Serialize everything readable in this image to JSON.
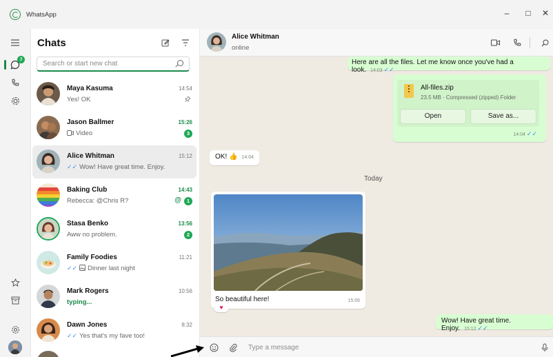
{
  "window": {
    "app_title": "WhatsApp",
    "controls": {
      "minimize": "–",
      "maximize": "□",
      "close": "✕"
    }
  },
  "rail": {
    "icons": [
      "menu-icon",
      "chats-icon",
      "calls-icon",
      "status-icon",
      "starred-icon",
      "archive-icon",
      "settings-icon",
      "profile-avatar"
    ],
    "chats_badge": "3"
  },
  "chat_list": {
    "title": "Chats",
    "search_placeholder": "Search or start new chat",
    "chats": [
      {
        "name": "Maya Kasuma",
        "preview": "Yes! OK",
        "time": "14:54",
        "pinned": true,
        "unread": "",
        "ticks": false,
        "icon": ""
      },
      {
        "name": "Jason Ballmer",
        "preview": "Video",
        "time": "15:26",
        "unread": "3",
        "ticks": false,
        "icon": "video"
      },
      {
        "name": "Alice Whitman",
        "preview": "Wow! Have great time. Enjoy.",
        "time": "15:12",
        "unread": "",
        "ticks": true,
        "icon": "",
        "selected": true
      },
      {
        "name": "Baking Club",
        "preview": "Rebecca: @Chris R?",
        "time": "14:43",
        "unread": "1",
        "mention": "@",
        "ticks": false,
        "icon": ""
      },
      {
        "name": "Stasa Benko",
        "preview": "Aww no problem.",
        "time": "13:56",
        "unread": "2",
        "ticks": false,
        "icon": ""
      },
      {
        "name": "Family Foodies",
        "preview": "Dinner last night",
        "time": "11:21",
        "unread": "",
        "ticks": true,
        "icon": "photo"
      },
      {
        "name": "Mark Rogers",
        "preview": "typing...",
        "time": "10:56",
        "unread": "",
        "ticks": false,
        "icon": "",
        "typing": true
      },
      {
        "name": "Dawn Jones",
        "preview": "Yes that's my fave too!",
        "time": "8:32",
        "unread": "",
        "ticks": true,
        "icon": ""
      }
    ]
  },
  "conversation": {
    "contact_name": "Alice Whitman",
    "contact_status": "online",
    "messages": {
      "files_msg": "Here are all the files. Let me know once you've had a look.",
      "files_msg_time": "14:03",
      "file_name": "All-files.zip",
      "file_meta": "23.5 MB · Compressed (zipped) Folder",
      "file_open": "Open",
      "file_save": "Save as...",
      "file_time": "14:04",
      "ok_msg": "OK! 👍",
      "ok_time": "14:04",
      "day_separator": "Today",
      "photo_caption": "So beautiful here!",
      "photo_time": "15:06",
      "photo_reaction": "♥",
      "last_msg": "Wow! Have great time. Enjoy.",
      "last_time": "15:12"
    },
    "composer_placeholder": "Type a message"
  },
  "colors": {
    "accent": "#1b8a4a",
    "outgoing_bubble": "#d9fdd3",
    "chat_background": "#efeae2",
    "read_ticks": "#3b8ee6"
  }
}
